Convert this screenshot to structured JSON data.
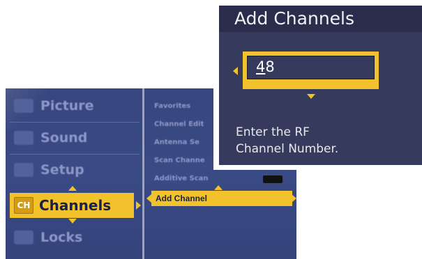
{
  "main_menu": {
    "items": [
      {
        "label": "Picture",
        "icon": "picture-icon"
      },
      {
        "label": "Sound",
        "icon": "speaker-icon"
      },
      {
        "label": "Setup",
        "icon": "gear-icon"
      },
      {
        "label": "Channels",
        "icon": "ch-icon",
        "icon_text": "CH",
        "selected": true
      },
      {
        "label": "Locks",
        "icon": "lock-icon"
      }
    ]
  },
  "sub_menu": {
    "items": [
      {
        "label": "Favorites"
      },
      {
        "label": "Channel Edit"
      },
      {
        "label": "Antenna Se"
      },
      {
        "label": "Scan Channe"
      },
      {
        "label": "Additive Scan"
      },
      {
        "label": "Add Channel",
        "selected": true
      }
    ]
  },
  "dialog": {
    "title": "Add Channels",
    "input_value_first": "4",
    "input_value_rest": "8",
    "help_line1": "Enter the RF",
    "help_line2": "Channel Number."
  },
  "colors": {
    "highlight": "#f1c22c",
    "menu_bg": "#37467e",
    "dialog_bg": "#363a5c",
    "dialog_title_bg": "#2a2d4c"
  }
}
